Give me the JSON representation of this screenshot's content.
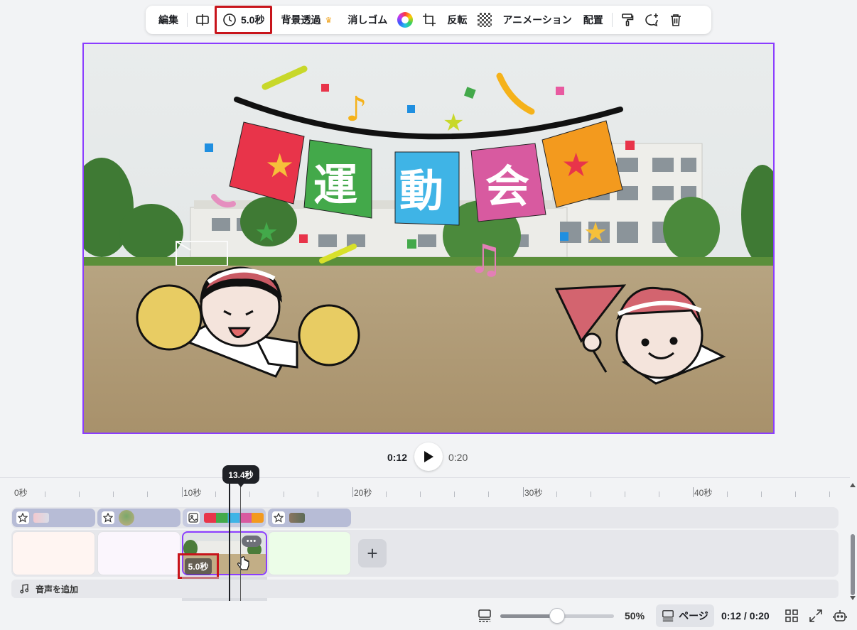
{
  "toolbar": {
    "edit_label": "編集",
    "duration_label": "5.0秒",
    "bg_remove_label": "背景透過",
    "eraser_label": "消しゴム",
    "flip_label": "反転",
    "animation_label": "アニメーション",
    "position_label": "配置",
    "icons": [
      "split-icon",
      "clock-icon",
      "crown-icon",
      "color-wheel-icon",
      "crop-icon",
      "transparency-icon",
      "paint-roller-icon",
      "comment-add-icon",
      "trash-icon"
    ]
  },
  "canvas": {
    "banner_chars": [
      "運",
      "動",
      "会"
    ],
    "colors": {
      "selection": "#8b3dff",
      "flag_red": "#e8344a",
      "flag_green": "#43a94a",
      "flag_blue": "#3fb4e6",
      "flag_pink": "#d85aa0",
      "flag_orange": "#f39a1e"
    }
  },
  "playback": {
    "current_time": "0:12",
    "total_time": "0:20"
  },
  "timeline": {
    "playhead_label": "13.4秒",
    "ruler_labels": [
      "0秒",
      "10秒",
      "20秒",
      "30秒",
      "40秒"
    ],
    "active_page_duration": "5.0秒",
    "add_audio_label": "音声を追加",
    "more_label": "•••",
    "add_page_label": "+"
  },
  "bottom_bar": {
    "zoom_percent": "50%",
    "zoom_value": 0.5,
    "page_view_label": "ページ",
    "time_display": "0:12 / 0:20"
  }
}
